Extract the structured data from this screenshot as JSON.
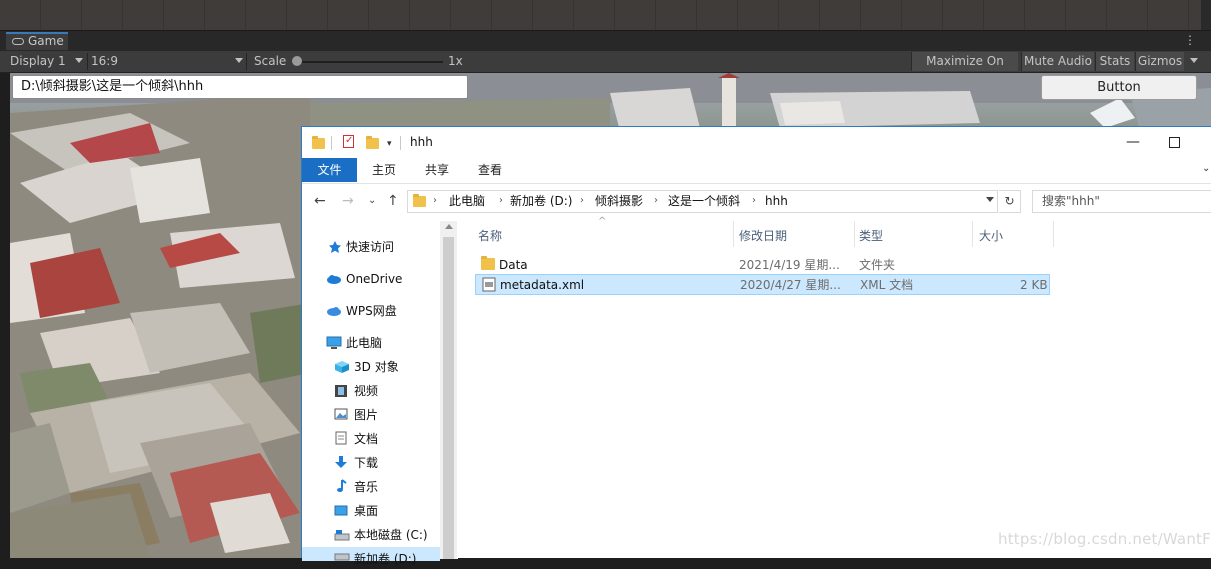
{
  "unity": {
    "game_tab_label": "Game",
    "toolbar": {
      "display": "Display 1",
      "aspect": "16:9",
      "scale_label": "Scale",
      "scale_value": "1x",
      "maximize": "Maximize On Play",
      "mute": "Mute Audio",
      "stats": "Stats",
      "gizmos": "Gizmos"
    },
    "menu_icon": "kebab-icon"
  },
  "game": {
    "path_input_value": "D:\\倾斜摄影\\这是一个倾斜\\hhh",
    "button_label": "Button"
  },
  "explorer": {
    "title": "hhh",
    "ribbon_tabs": [
      "文件",
      "主页",
      "共享",
      "查看"
    ],
    "breadcrumb": [
      "此电脑",
      "新加卷 (D:)",
      "倾斜摄影",
      "这是一个倾斜",
      "hhh"
    ],
    "search_placeholder": "搜索\"hhh\"",
    "nav": [
      {
        "label": "快速访问",
        "icon": "star-icon"
      },
      {
        "label": "OneDrive",
        "icon": "cloud-icon"
      },
      {
        "label": "WPS网盘",
        "icon": "cloud-icon"
      },
      {
        "label": "此电脑",
        "icon": "computer-icon"
      },
      {
        "label": "3D 对象",
        "icon": "cube-icon"
      },
      {
        "label": "视频",
        "icon": "film-icon"
      },
      {
        "label": "图片",
        "icon": "picture-icon"
      },
      {
        "label": "文档",
        "icon": "document-icon"
      },
      {
        "label": "下载",
        "icon": "download-icon"
      },
      {
        "label": "音乐",
        "icon": "music-icon"
      },
      {
        "label": "桌面",
        "icon": "desktop-icon"
      },
      {
        "label": "本地磁盘 (C:)",
        "icon": "drive-icon"
      },
      {
        "label": "新加卷 (D:)",
        "icon": "drive-icon"
      }
    ],
    "columns": [
      "名称",
      "修改日期",
      "类型",
      "大小"
    ],
    "files": [
      {
        "name": "Data",
        "date": "2021/4/19 星期...",
        "type": "文件夹",
        "size": "",
        "icon": "folder-icon"
      },
      {
        "name": "metadata.xml",
        "date": "2020/4/27 星期...",
        "type": "XML 文档",
        "size": "2 KB",
        "icon": "xml-file-icon"
      }
    ]
  },
  "watermark": "https://blog.csdn.net/WantFK",
  "colors": {
    "accent": "#1a6fc4",
    "selection": "#cce8ff",
    "folder": "#f1c24b"
  }
}
